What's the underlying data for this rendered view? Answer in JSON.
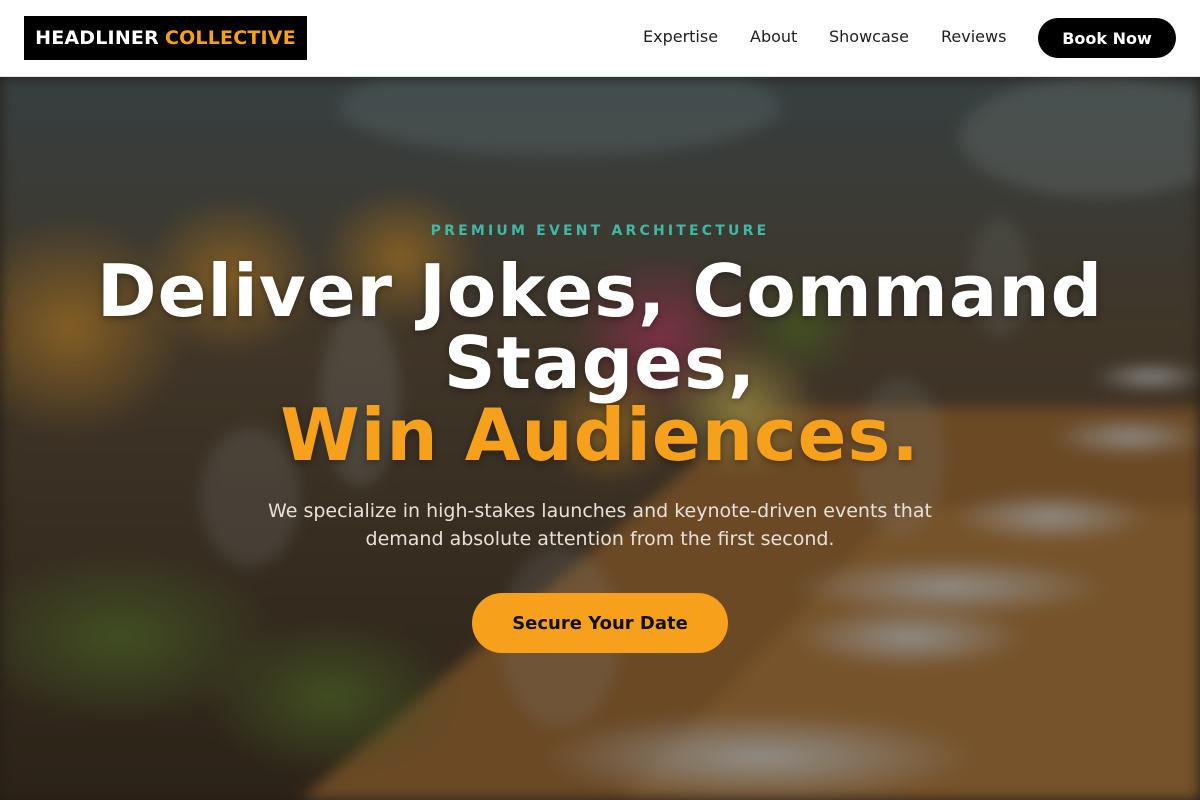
{
  "brand": {
    "name_primary": "HEADLINER",
    "name_accent": "COLLECTIVE"
  },
  "nav": {
    "items": [
      {
        "label": "Expertise"
      },
      {
        "label": "About"
      },
      {
        "label": "Showcase"
      },
      {
        "label": "Reviews"
      }
    ],
    "cta_label": "Book Now"
  },
  "hero": {
    "eyebrow": "PREMIUM EVENT ARCHITECTURE",
    "title_line1": "Deliver Jokes, Command",
    "title_line2": "Stages,",
    "title_accent": "Win Audiences.",
    "subtitle": "We specialize in high-stakes launches and keynote-driven events that demand absolute attention from the first second.",
    "cta_label": "Secure Your Date",
    "background_image": "banquet-table-photo"
  },
  "colors": {
    "accent": "#f7a01c",
    "eyebrow": "#3fb8a8",
    "dark": "#000000",
    "overlay": "rgba(0,0,0,0.40)"
  }
}
